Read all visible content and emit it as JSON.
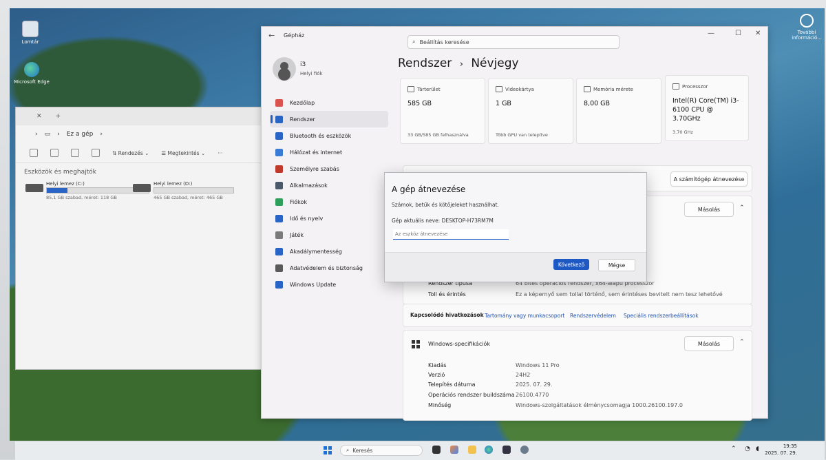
{
  "desktop": {
    "icons": [
      {
        "label": "Lomtár"
      },
      {
        "label": "Microsoft Edge"
      }
    ],
    "corner_app": {
      "label": "További információ..."
    }
  },
  "explorer": {
    "address": "Ez a gép",
    "toolbar": {
      "sort": "Rendezés",
      "view": "Megtekintés",
      "more": "···"
    },
    "section_title": "Eszközök és meghajtók",
    "drives": [
      {
        "label": "Helyi lemez (C:)",
        "caption": "85,1 GB szabad, méret: 118 GB",
        "used": 0.28
      },
      {
        "label": "Helyi lemez (D:)",
        "caption": "465 GB szabad, méret: 465 GB",
        "used": 0.0
      }
    ]
  },
  "settings": {
    "app_title": "Gépház",
    "search_placeholder": "Beállítás keresése",
    "user": {
      "name": "i3",
      "sub": "Helyi fiók"
    },
    "nav": [
      {
        "label": "Kezdőlap",
        "color": "#d9534f"
      },
      {
        "label": "Rendszer",
        "color": "#2a64c4",
        "active": true
      },
      {
        "label": "Bluetooth és eszközök",
        "color": "#2a64c4"
      },
      {
        "label": "Hálózat és internet",
        "color": "#3a7bd5"
      },
      {
        "label": "Személyre szabás",
        "color": "#c0392b"
      },
      {
        "label": "Alkalmazások",
        "color": "#4a5a6a"
      },
      {
        "label": "Fiókok",
        "color": "#2e9e5b"
      },
      {
        "label": "Idő és nyelv",
        "color": "#2a64c4"
      },
      {
        "label": "Játék",
        "color": "#7a7a7a"
      },
      {
        "label": "Akadálymentesség",
        "color": "#2a64c4"
      },
      {
        "label": "Adatvédelem és biztonság",
        "color": "#5a5a5a"
      },
      {
        "label": "Windows Update",
        "color": "#2a64c4"
      }
    ],
    "breadcrumb": {
      "parent": "Rendszer",
      "sep": "›",
      "current": "Névjegy"
    },
    "cards": [
      {
        "header": "Tárterület",
        "value": "585 GB",
        "sub": "33 GB/585 GB felhasználva"
      },
      {
        "header": "Videokártya",
        "value": "1 GB",
        "sub": "Több GPU van telepítve"
      },
      {
        "header": "Memória mérete",
        "value": "8,00 GB",
        "sub": ""
      },
      {
        "header": "Processzor",
        "value": "Intel(R) Core(TM) i3-6100 CPU @ 3.70GHz",
        "sub": "3.70 GHz"
      }
    ],
    "rename_button": "A számítógép átnevezése",
    "device_specs": {
      "copy": "Másolás",
      "rows": [
        {
          "key": "Rendszer típusa",
          "value": "64 bites operációs rendszer, x64-alapú processzor"
        },
        {
          "key": "Toll és érintés",
          "value": "Ez a képernyő sem tollal történő, sem érintéses bevitelt nem tesz lehetővé"
        }
      ]
    },
    "related": {
      "title": "Kapcsolódó hivatkozások",
      "links": [
        "Tartomány vagy munkacsoport",
        "Rendszervédelem",
        "Speciális rendszerbeállítások"
      ]
    },
    "windows_specs": {
      "title": "Windows-specifikációk",
      "copy": "Másolás",
      "rows": [
        {
          "key": "Kiadás",
          "value": "Windows 11 Pro"
        },
        {
          "key": "Verzió",
          "value": "24H2"
        },
        {
          "key": "Telepítés dátuma",
          "value": "2025. 07. 29."
        },
        {
          "key": "Operációs rendszer buildszáma",
          "value": "26100.4770"
        },
        {
          "key": "Minőség",
          "value": "Windows-szolgáltatások élménycsomagja 1000.26100.197.0"
        }
      ]
    }
  },
  "dialog": {
    "title": "A gép átnevezése",
    "text": "Számok, betűk és kötőjeleket használhat.",
    "current": "Gép aktuális neve: DESKTOP-H73RM7M",
    "input_placeholder": "Az eszköz átnevezése",
    "next": "Következő",
    "cancel": "Mégse"
  },
  "taskbar": {
    "search_placeholder": "Keresés",
    "time": "19:35",
    "date": "2025. 07. 29."
  }
}
